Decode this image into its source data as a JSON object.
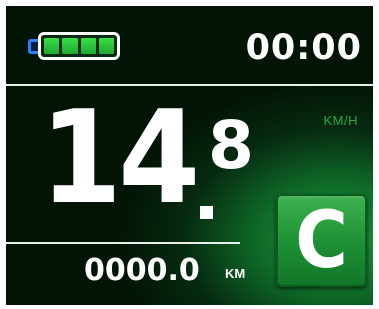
{
  "status": {
    "battery_cells_filled": 4,
    "battery_cells_total": 4,
    "clock": "00:00"
  },
  "speed": {
    "integer": "14",
    "decimal": "8",
    "unit": "KM/H"
  },
  "odometer": {
    "value": "0000.0",
    "unit": "KM"
  },
  "mode": {
    "label": "C"
  },
  "colors": {
    "accent": "#1fae42",
    "battery_fill": "#37e04a",
    "battery_nub": "#2f7cff",
    "text": "#ffffff",
    "background": "#031807"
  },
  "icons": {
    "battery": "battery-icon"
  }
}
